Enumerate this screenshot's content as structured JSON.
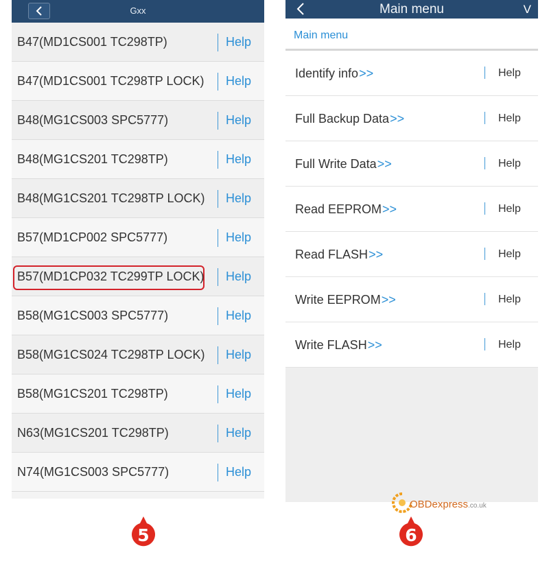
{
  "left": {
    "header": {
      "title": "Gxx",
      "back_icon": "chevron-left-icon"
    },
    "items": [
      {
        "label": "B47(MD1CS001 TC298TP)",
        "help": "Help"
      },
      {
        "label": "B47(MD1CS001 TC298TP LOCK)",
        "help": "Help"
      },
      {
        "label": "B48(MG1CS003 SPC5777)",
        "help": "Help"
      },
      {
        "label": "B48(MG1CS201 TC298TP)",
        "help": "Help"
      },
      {
        "label": "B48(MG1CS201 TC298TP LOCK)",
        "help": "Help"
      },
      {
        "label": "B57(MD1CP002 SPC5777)",
        "help": "Help"
      },
      {
        "label": "B57(MD1CP032 TC299TP LOCK)",
        "help": "Help",
        "highlighted": true
      },
      {
        "label": "B58(MG1CS003 SPC5777)",
        "help": "Help"
      },
      {
        "label": "B58(MG1CS024 TC298TP LOCK)",
        "help": "Help"
      },
      {
        "label": "B58(MG1CS201 TC298TP)",
        "help": "Help"
      },
      {
        "label": "N63(MG1CS201 TC298TP)",
        "help": "Help"
      },
      {
        "label": "N74(MG1CS003 SPC5777)",
        "help": "Help"
      }
    ],
    "step_badge": "5"
  },
  "right": {
    "header": {
      "title": "Main menu",
      "version": "V",
      "back_icon": "chevron-left-icon"
    },
    "breadcrumb": "Main menu",
    "items": [
      {
        "label": "Identify info",
        "arrow": ">>",
        "help": "Help"
      },
      {
        "label": "Full Backup Data",
        "arrow": ">>",
        "help": "Help"
      },
      {
        "label": "Full Write Data",
        "arrow": ">>",
        "help": "Help"
      },
      {
        "label": "Read EEPROM",
        "arrow": ">>",
        "help": "Help"
      },
      {
        "label": "Read FLASH",
        "arrow": ">>",
        "help": "Help"
      },
      {
        "label": "Write EEPROM",
        "arrow": ">>",
        "help": "Help"
      },
      {
        "label": "Write FLASH",
        "arrow": ">>",
        "help": "Help"
      }
    ],
    "step_badge": "6"
  },
  "watermark": {
    "brand": "OBDexpress",
    "domain": ".co.uk"
  },
  "colors": {
    "header_bg": "#274a70",
    "accent_blue": "#2b8fd6",
    "highlight_red": "#d3222a",
    "badge_red": "#e02a1f"
  }
}
